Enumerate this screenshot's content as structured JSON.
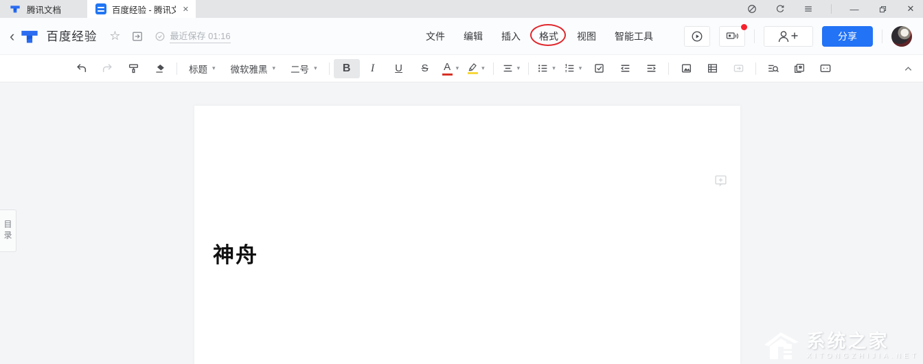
{
  "icons": {
    "close_tab": "✕",
    "window_close": "✕",
    "window_minimize": "—",
    "back": "‹",
    "star": "☆",
    "caret": "▾",
    "toc_vertical": "目录"
  },
  "tabbar": {
    "home_tab_label": "腾讯文档",
    "doc_tab_label": "百度经验 - 腾讯文"
  },
  "header": {
    "title": "百度经验",
    "save_status": "最近保存 01:16",
    "menus": [
      {
        "label": "文件"
      },
      {
        "label": "编辑"
      },
      {
        "label": "插入"
      },
      {
        "label": "格式",
        "annotated": true
      },
      {
        "label": "视图"
      },
      {
        "label": "智能工具"
      }
    ],
    "share_label": "分享"
  },
  "toolbar": {
    "style_dropdown": "标题",
    "font_dropdown": "微软雅黑",
    "size_dropdown": "二号",
    "bold": "B",
    "italic": "I",
    "underline": "U",
    "strikethrough": "S",
    "font_color": "A"
  },
  "document": {
    "heading": "神舟"
  },
  "watermark": {
    "title": "系统之家",
    "subtitle": "XITONGZHIJIA.NET"
  },
  "colors": {
    "accent_blue": "#2273f5",
    "annotation_red": "#e0272c",
    "badge_red": "#f5222d"
  }
}
